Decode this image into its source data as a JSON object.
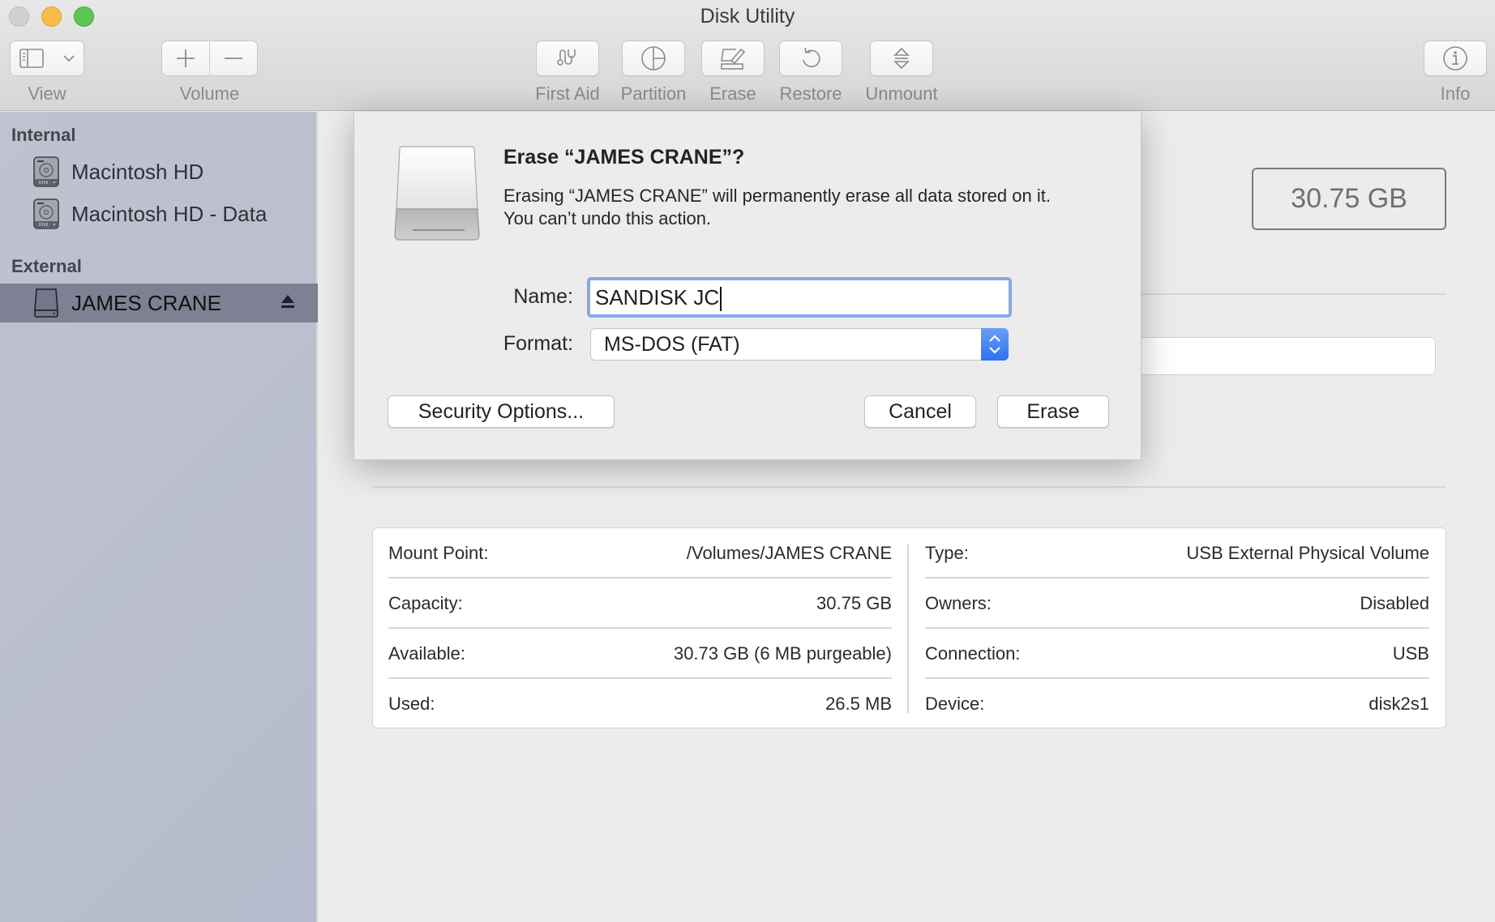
{
  "window": {
    "title": "Disk Utility"
  },
  "toolbar": {
    "view": {
      "label": "View",
      "icon": "sidebar-toggle-icon"
    },
    "volume": {
      "label": "Volume",
      "add_icon": "plus-icon",
      "remove_icon": "minus-icon"
    },
    "first_aid": {
      "label": "First Aid",
      "icon": "stethoscope-icon"
    },
    "partition": {
      "label": "Partition",
      "icon": "pie-chart-icon"
    },
    "erase": {
      "label": "Erase",
      "icon": "erase-icon"
    },
    "restore": {
      "label": "Restore",
      "icon": "restore-icon"
    },
    "unmount": {
      "label": "Unmount",
      "icon": "unmount-icon"
    },
    "info": {
      "label": "Info",
      "icon": "info-icon"
    }
  },
  "sidebar": {
    "sections": [
      {
        "title": "Internal",
        "items": [
          {
            "label": "Macintosh HD",
            "icon": "internal-disk-icon"
          },
          {
            "label": "Macintosh HD - Data",
            "icon": "internal-disk-icon"
          }
        ]
      },
      {
        "title": "External",
        "items": [
          {
            "label": "JAMES CRANE",
            "icon": "external-disk-icon",
            "selected": true,
            "eject_icon": "eject-icon"
          }
        ]
      }
    ]
  },
  "main": {
    "capacity_badge": "30.75 GB",
    "info_left": [
      {
        "label": "Mount Point:",
        "value": "/Volumes/JAMES CRANE"
      },
      {
        "label": "Capacity:",
        "value": "30.75 GB"
      },
      {
        "label": "Available:",
        "value": "30.73 GB (6 MB purgeable)"
      },
      {
        "label": "Used:",
        "value": "26.5 MB"
      }
    ],
    "info_right": [
      {
        "label": "Type:",
        "value": "USB External Physical Volume"
      },
      {
        "label": "Owners:",
        "value": "Disabled"
      },
      {
        "label": "Connection:",
        "value": "USB"
      },
      {
        "label": "Device:",
        "value": "disk2s1"
      }
    ]
  },
  "erase_sheet": {
    "title": "Erase “JAMES CRANE”?",
    "message_line1": "Erasing “JAMES CRANE” will permanently erase all data stored on it.",
    "message_line2": "You can’t undo this action.",
    "name_label": "Name:",
    "name_value": "SANDISK JC",
    "format_label": "Format:",
    "format_value": "MS-DOS (FAT)",
    "security_options_label": "Security Options...",
    "cancel_label": "Cancel",
    "erase_label": "Erase",
    "accent_color": "#2a73f4",
    "focus_ring_color": "#85a8e8"
  }
}
